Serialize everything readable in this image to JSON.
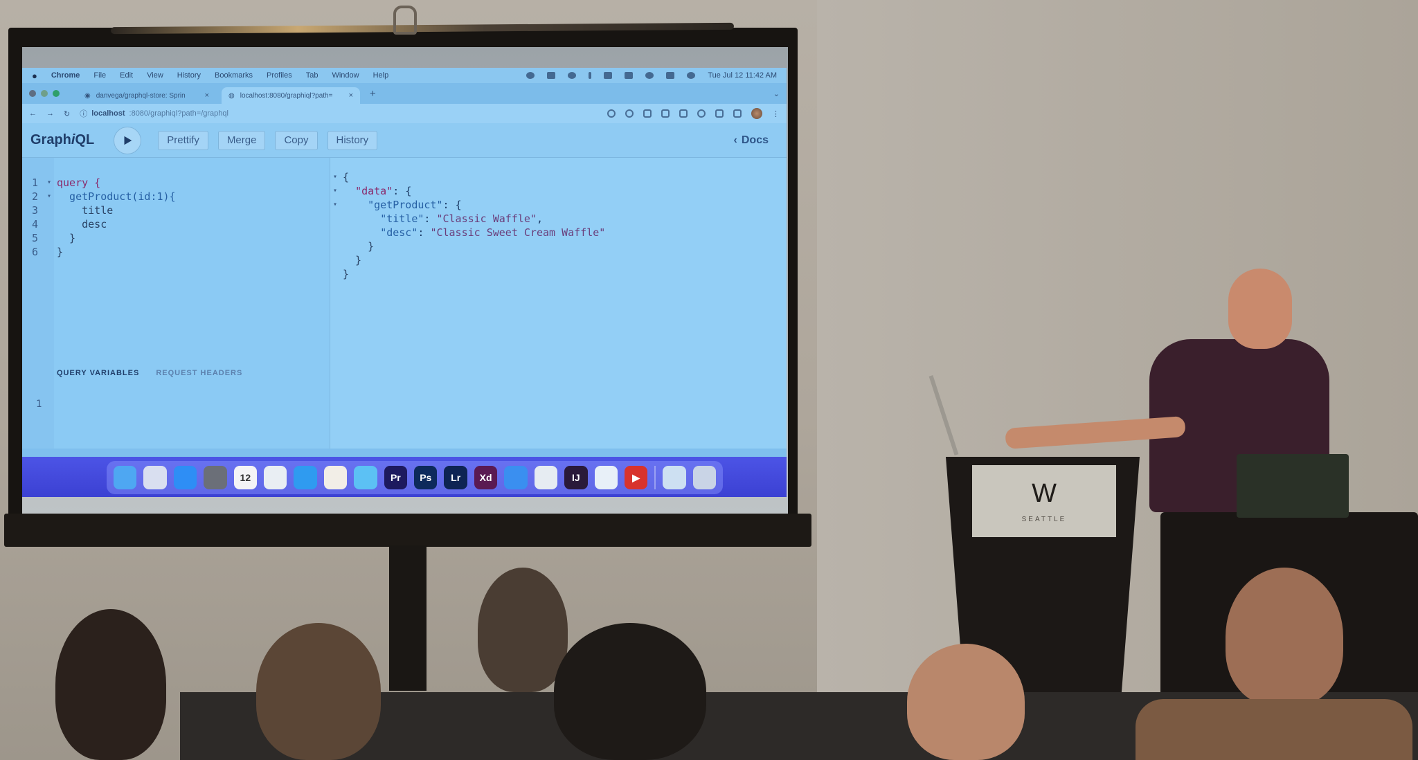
{
  "scene": {
    "podium_sign": {
      "logo": "W",
      "city": "SEATTLE"
    }
  },
  "macos": {
    "menubar": {
      "apple_icon": "apple-icon",
      "app_name": "Chrome",
      "menus": [
        "File",
        "Edit",
        "View",
        "History",
        "Bookmarks",
        "Profiles",
        "Tab",
        "Window",
        "Help"
      ],
      "clock": "Tue Jul 12  11:42 AM"
    },
    "dock": {
      "apps": [
        {
          "name": "finder",
          "label": ""
        },
        {
          "name": "launchpad",
          "label": ""
        },
        {
          "name": "app-store",
          "label": ""
        },
        {
          "name": "system-preferences",
          "label": ""
        },
        {
          "name": "calendar",
          "label": "12"
        },
        {
          "name": "chrome",
          "label": ""
        },
        {
          "name": "safari",
          "label": ""
        },
        {
          "name": "photos",
          "label": ""
        },
        {
          "name": "messages",
          "label": ""
        },
        {
          "name": "premiere-pro",
          "label": "Pr"
        },
        {
          "name": "photoshop",
          "label": "Ps"
        },
        {
          "name": "lightroom",
          "label": "Lr"
        },
        {
          "name": "adobe-xd",
          "label": "Xd"
        },
        {
          "name": "keynote",
          "label": ""
        },
        {
          "name": "screenshot",
          "label": ""
        },
        {
          "name": "intellij",
          "label": "IJ"
        },
        {
          "name": "vscode",
          "label": ""
        },
        {
          "name": "youtube",
          "label": "▶"
        },
        {
          "name": "screen-preview",
          "label": ""
        },
        {
          "name": "trash",
          "label": ""
        }
      ]
    }
  },
  "browser": {
    "tabs": [
      {
        "title": "danvega/graphql-store: Sprin",
        "icon": "github-icon",
        "active": false
      },
      {
        "title": "localhost:8080/graphiql?path=",
        "icon": "globe-icon",
        "active": true
      }
    ],
    "new_tab": "+",
    "address": {
      "host": "localhost",
      "path": ":8080/graphiql?path=/graphql"
    }
  },
  "graphiql": {
    "logo_prefix": "Graph",
    "logo_i": "i",
    "logo_suffix": "QL",
    "buttons": {
      "prettify": "Prettify",
      "merge": "Merge",
      "copy": "Copy",
      "history": "History"
    },
    "docs": "Docs",
    "query_lines": [
      {
        "n": "1",
        "fold": "▾",
        "text": "query {"
      },
      {
        "n": "2",
        "fold": "▾",
        "text": "  getProduct(id:1){"
      },
      {
        "n": "3",
        "fold": "",
        "text": "    title"
      },
      {
        "n": "4",
        "fold": "",
        "text": "    desc"
      },
      {
        "n": "5",
        "fold": "",
        "text": "  }"
      },
      {
        "n": "6",
        "fold": "",
        "text": "}"
      }
    ],
    "variables_tabs": {
      "active": "QUERY VARIABLES",
      "inactive": "REQUEST HEADERS"
    },
    "variables_line": "1",
    "result_lines": [
      {
        "fold": "▾",
        "text": "{"
      },
      {
        "fold": "▾",
        "text": "  \"data\": {"
      },
      {
        "fold": "▾",
        "text": "    \"getProduct\": {"
      },
      {
        "fold": "",
        "text": "      \"title\": \"Classic Waffle\","
      },
      {
        "fold": "",
        "text": "      \"desc\": \"Classic Sweet Cream Waffle\""
      },
      {
        "fold": "",
        "text": "    }"
      },
      {
        "fold": "",
        "text": "  }"
      },
      {
        "fold": "",
        "text": "}"
      }
    ]
  }
}
